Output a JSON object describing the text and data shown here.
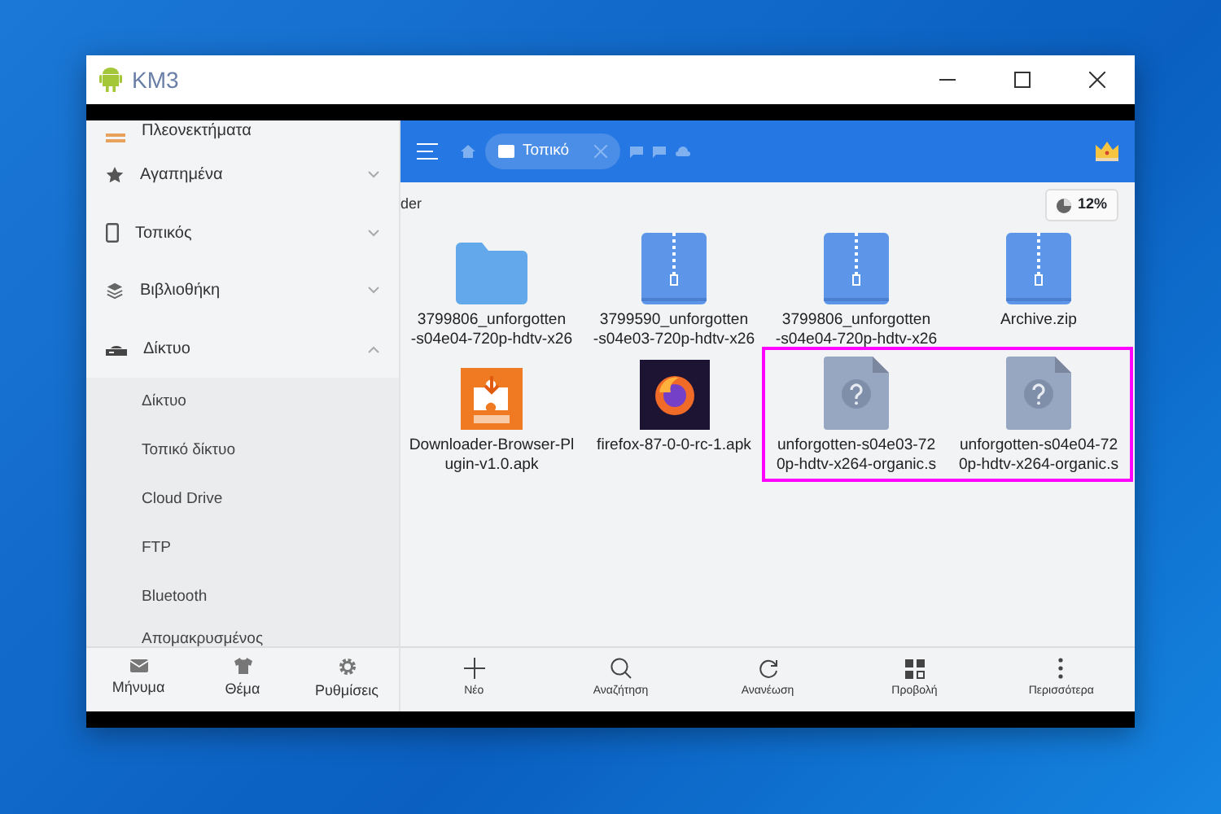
{
  "window": {
    "title": "KM3"
  },
  "sidebar": {
    "items": [
      {
        "label": "Πλεονεκτήματα",
        "kind": "perks"
      },
      {
        "label": "Αγαπημένα",
        "kind": "favorites",
        "expanded": false
      },
      {
        "label": "Τοπικός",
        "kind": "local",
        "expanded": false
      },
      {
        "label": "Βιβλιοθήκη",
        "kind": "library",
        "expanded": false
      },
      {
        "label": "Δίκτυο",
        "kind": "network",
        "expanded": true,
        "children": [
          {
            "label": "Δίκτυο"
          },
          {
            "label": "Τοπικό δίκτυο"
          },
          {
            "label": "Cloud Drive"
          },
          {
            "label": "FTP"
          },
          {
            "label": "Bluetooth"
          },
          {
            "label": "Απομακρυσμένος"
          }
        ]
      }
    ]
  },
  "sidebar_bottom": [
    {
      "label": "Μήνυμα",
      "kind": "message"
    },
    {
      "label": "Θέμα",
      "kind": "theme"
    },
    {
      "label": "Ρυθμίσεις",
      "kind": "settings"
    }
  ],
  "toolbar": {
    "tab": {
      "label": "Τοπικό"
    }
  },
  "path": "der",
  "storage": "12%",
  "file_rows": [
    [
      {
        "name": "3799806_unforgotten\n-s04e04-720p-hdtv-x26",
        "kind": "folder",
        "highlighted": false
      },
      {
        "name": "3799590_unforgotten\n-s04e03-720p-hdtv-x26",
        "kind": "zip",
        "highlighted": false
      },
      {
        "name": "3799806_unforgotten\n-s04e04-720p-hdtv-x26",
        "kind": "zip",
        "highlighted": false
      },
      {
        "name": "Archive.zip",
        "kind": "zip",
        "highlighted": false
      }
    ],
    [
      {
        "name": "Downloader-Browser-Pl\nugin-v1.0.apk",
        "kind": "plugin",
        "highlighted": false
      },
      {
        "name": "firefox-87-0-0-rc-1.apk",
        "kind": "browser",
        "highlighted": false
      },
      {
        "name": "unforgotten-s04e03-72\n0p-hdtv-x264-organic.s",
        "kind": "unknown",
        "highlighted": true
      },
      {
        "name": "unforgotten-s04e04-72\n0p-hdtv-x264-organic.s",
        "kind": "unknown",
        "highlighted": true
      }
    ]
  ],
  "bottom_toolbar": [
    {
      "label": "Νέο",
      "kind": "new"
    },
    {
      "label": "Αναζήτηση",
      "kind": "search"
    },
    {
      "label": "Ανανέωση",
      "kind": "refresh"
    },
    {
      "label": "Προβολή",
      "kind": "view"
    },
    {
      "label": "Περισσότερα",
      "kind": "more"
    }
  ]
}
